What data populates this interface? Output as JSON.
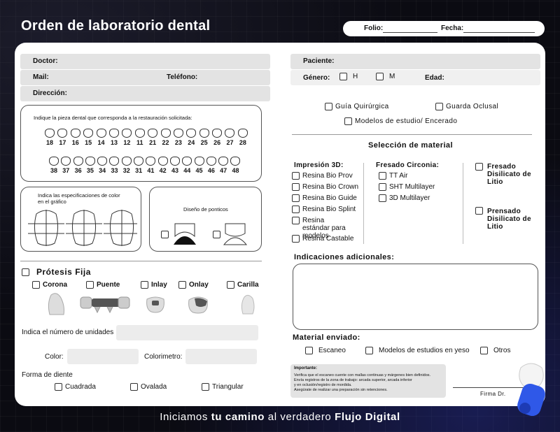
{
  "header": {
    "title": "Orden de laboratorio dental",
    "folio_label": "Folio:",
    "fecha_label": "Fecha:"
  },
  "doctor_info": {
    "doctor_label": "Doctor:",
    "mail_label": "Mail:",
    "telefono_label": "Teléfono:",
    "direccion_label": "Dirección:"
  },
  "patient_info": {
    "paciente_label": "Paciente:",
    "genero_label": "Género:",
    "h_label": "H",
    "m_label": "M",
    "edad_label": "Edad:"
  },
  "odontogram": {
    "instruction": "Indique la pieza dental que corresponda a la restauración solicitada:",
    "upper": [
      "18",
      "17",
      "16",
      "15",
      "14",
      "13",
      "12",
      "11",
      "21",
      "22",
      "23",
      "24",
      "25",
      "26",
      "27",
      "28"
    ],
    "lower": [
      "38",
      "37",
      "36",
      "35",
      "34",
      "33",
      "32",
      "31",
      "41",
      "42",
      "43",
      "44",
      "45",
      "46",
      "47",
      "48"
    ]
  },
  "color_spec": {
    "label": "Indica las especificaciones de color en el gráfico"
  },
  "pontic_design": {
    "label": "Diseño de ponticos"
  },
  "fixed_prosthesis": {
    "title": "Prótesis Fija",
    "options": [
      "Corona",
      "Puente",
      "Inlay",
      "Onlay",
      "Carilla"
    ],
    "units_label": "Indica el número de unidades",
    "color_label": "Color:",
    "colorimeter_label": "Colorimetro:"
  },
  "tooth_shape": {
    "label": "Forma de diente",
    "options": [
      "Cuadrada",
      "Ovalada",
      "Triangular"
    ]
  },
  "guides": {
    "guia": "Guía Quirúrgica",
    "guarda": "Guarda Oclusal",
    "modelos": "Modelos de estudio/ Encerado"
  },
  "material": {
    "title": "Selección de material",
    "print3d_title": "Impresión 3D:",
    "print3d_options": [
      "Resina Bio Prov",
      "Resina Bio Crown",
      "Resina Bio Guide",
      "Resina Bio Splint",
      "Resina estándar para modelos",
      "Resina Castable"
    ],
    "zirconia_title": "Fresado Circonia:",
    "zirconia_options": [
      "TT Air",
      "SHT Multilayer",
      "3D Multilayer"
    ],
    "disilicate_milled": "Fresado Disilicato de Litio",
    "disilicate_pressed": "Prensado Disilicato de Litio"
  },
  "indications": {
    "title": "Indicaciones adicionales:"
  },
  "sent_material": {
    "title": "Material enviado:",
    "options": [
      "Escaneo",
      "Modelos de estudios en yeso",
      "Otros"
    ]
  },
  "important": {
    "title": "Importante:",
    "lines": [
      "Verifica que el escaneo cuente con mallas continuas y márgenes bien definidos.",
      "Envía registros de la zona de trabajo: arcada superior, arcada inferior",
      "y en oclusión/registro de mordida.",
      "Asegúrate de realizar una preparación sin retenciones."
    ]
  },
  "signature": {
    "label": "Firma Dr."
  },
  "footer": {
    "part1": "Iniciamos ",
    "part2": "tu camino",
    "part3": " al verdadero ",
    "part4": "Flujo Digital"
  }
}
